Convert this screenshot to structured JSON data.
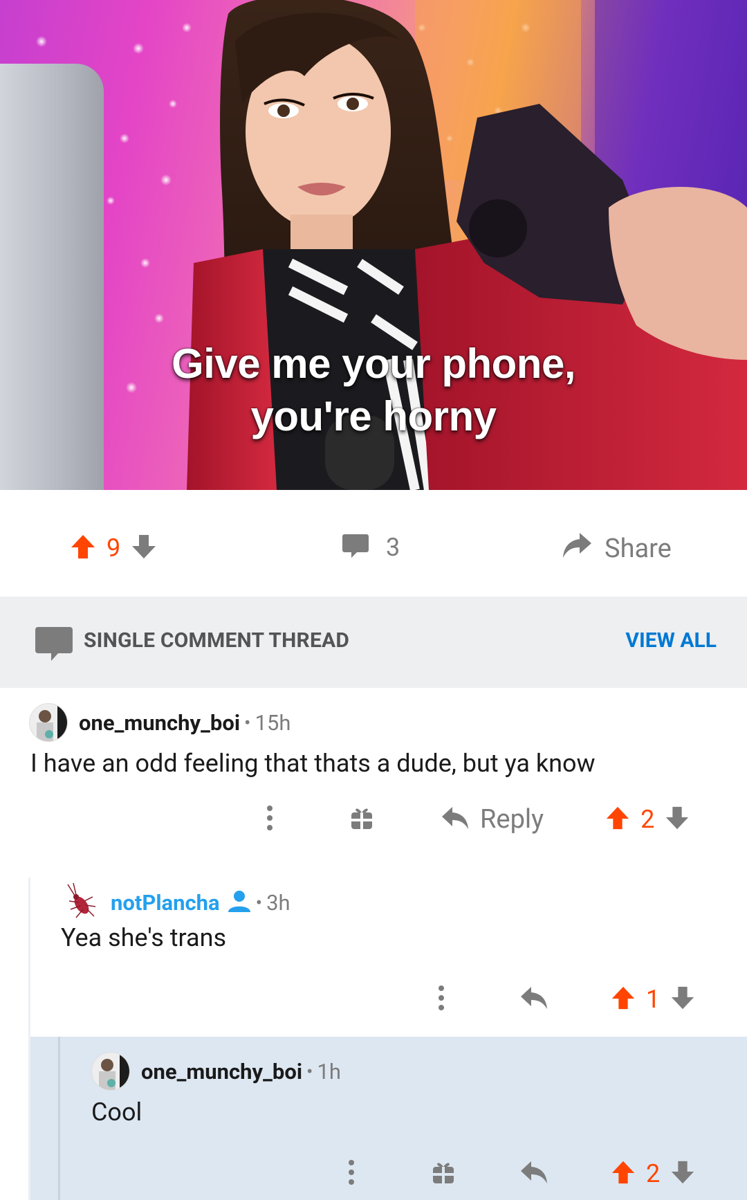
{
  "post": {
    "caption_line1": "Give me your phone,",
    "caption_line2": "you're horny",
    "score": "9",
    "comment_count": "3",
    "share_label": "Share"
  },
  "thread": {
    "label": "SINGLE COMMENT THREAD",
    "view_all": "VIEW ALL"
  },
  "comments": [
    {
      "username": "one_munchy_boi",
      "age": "15h",
      "text": "I have an odd feeling that thats a dude, but ya know",
      "reply_label": "Reply",
      "score": "2"
    },
    {
      "username": "notPlancha",
      "age": "3h",
      "text": "Yea she's trans",
      "score": "1"
    },
    {
      "username": "one_munchy_boi",
      "age": "1h",
      "text": "Cool",
      "score": "2"
    }
  ],
  "colors": {
    "upvote": "#ff4500",
    "muted": "#7c7c7c",
    "link": "#0079d3",
    "op_blue": "#24a0ed",
    "highlight_bg": "#dde7f1"
  },
  "icons": [
    "upvote-icon",
    "downvote-icon",
    "comment-icon",
    "share-icon",
    "more-icon",
    "award-icon",
    "reply-icon",
    "user-icon"
  ]
}
